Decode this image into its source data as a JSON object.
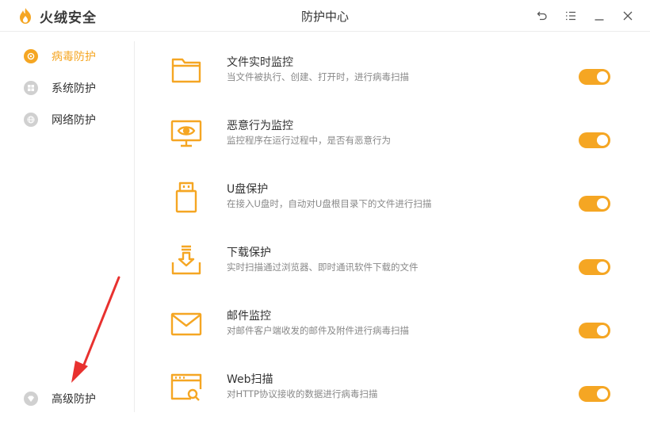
{
  "app": {
    "brand_name": "火绒安全",
    "window_title": "防护中心"
  },
  "window_controls": [
    {
      "name": "back-icon"
    },
    {
      "name": "menu-icon"
    },
    {
      "name": "minimize-icon"
    },
    {
      "name": "close-icon"
    }
  ],
  "sidebar": {
    "items": [
      {
        "label": "病毒防护",
        "icon": "virus-shield-icon",
        "active": true
      },
      {
        "label": "系统防护",
        "icon": "windows-icon",
        "active": false
      },
      {
        "label": "网络防护",
        "icon": "globe-icon",
        "active": false
      },
      {
        "label": "高级防护",
        "icon": "gem-icon",
        "active": false
      }
    ]
  },
  "protection_items": [
    {
      "title": "文件实时监控",
      "description": "当文件被执行、创建、打开时，进行病毒扫描",
      "icon": "folder-icon",
      "enabled": true
    },
    {
      "title": "恶意行为监控",
      "description": "监控程序在运行过程中，是否有恶意行为",
      "icon": "monitor-eye-icon",
      "enabled": true
    },
    {
      "title": "U盘保护",
      "description": "在接入U盘时，自动对U盘根目录下的文件进行扫描",
      "icon": "usb-drive-icon",
      "enabled": true
    },
    {
      "title": "下载保护",
      "description": "实时扫描通过浏览器、即时通讯软件下载的文件",
      "icon": "download-tray-icon",
      "enabled": true
    },
    {
      "title": "邮件监控",
      "description": "对邮件客户端收发的邮件及附件进行病毒扫描",
      "icon": "mail-icon",
      "enabled": true
    },
    {
      "title": "Web扫描",
      "description": "对HTTP协议接收的数据进行病毒扫描",
      "icon": "web-scan-icon",
      "enabled": true
    }
  ],
  "colors": {
    "accent": "#f5a623",
    "annotation_arrow": "#e8312f",
    "inactive_icon": "#d0d0d0"
  }
}
